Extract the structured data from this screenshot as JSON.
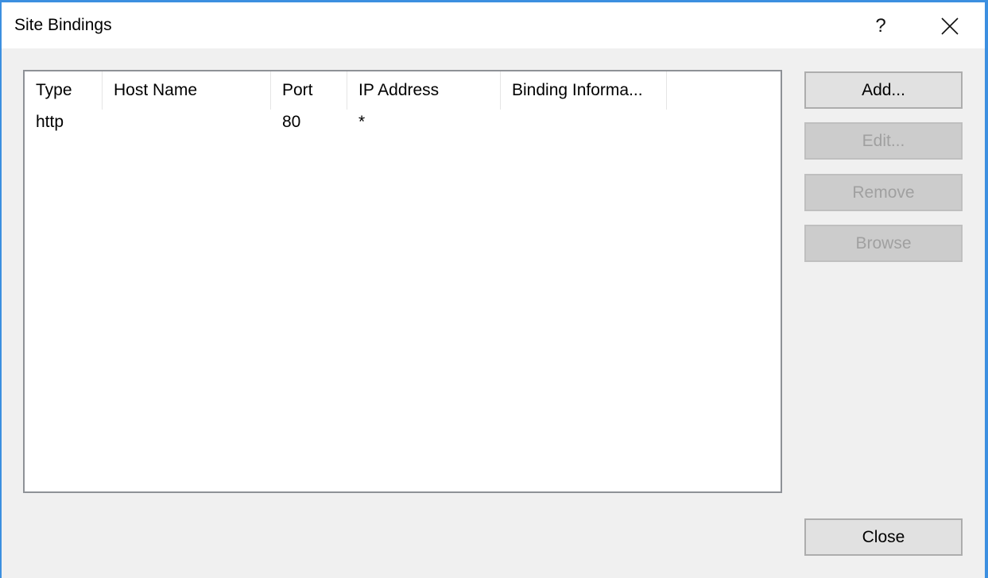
{
  "window": {
    "title": "Site Bindings",
    "help_label": "?",
    "close_label": "✕"
  },
  "table": {
    "columns": [
      "Type",
      "Host Name",
      "Port",
      "IP Address",
      "Binding Informa..."
    ],
    "rows": [
      [
        "http",
        "",
        "80",
        "*",
        ""
      ]
    ]
  },
  "buttons": {
    "add": {
      "label": "Add...",
      "enabled": true
    },
    "edit": {
      "label": "Edit...",
      "enabled": false
    },
    "remove": {
      "label": "Remove",
      "enabled": false
    },
    "browse": {
      "label": "Browse",
      "enabled": false
    },
    "close": {
      "label": "Close",
      "enabled": true
    }
  },
  "colors": {
    "window_border": "#3c8fe0",
    "dialog_bg": "#f0f0f0",
    "button_bg": "#e1e1e1",
    "disabled_button_bg": "#cccccc",
    "disabled_text": "#a0a0a0"
  }
}
